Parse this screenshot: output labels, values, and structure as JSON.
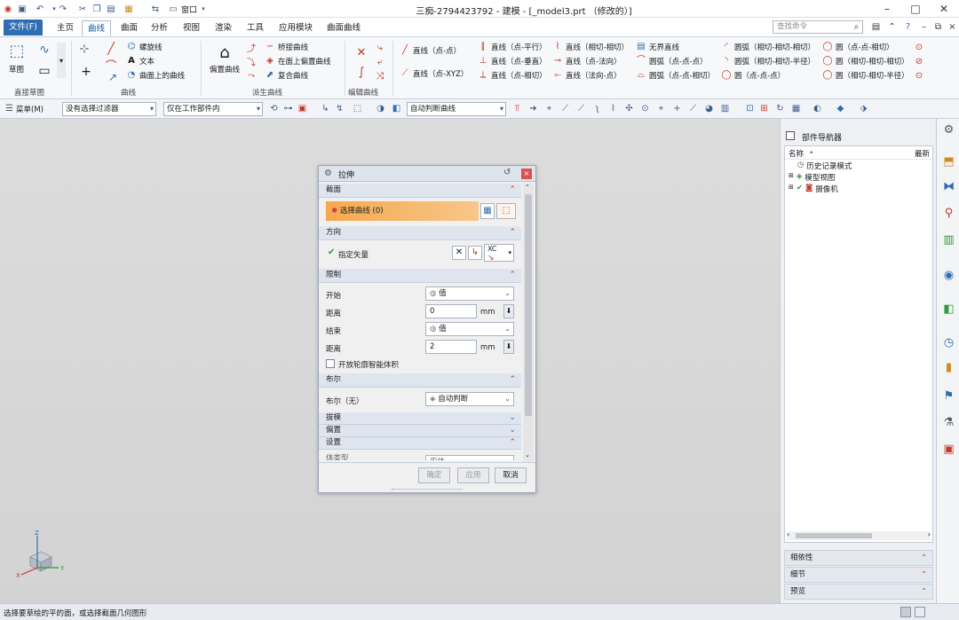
{
  "titlebar": {
    "title": "三痴-2794423792 - 建模 - [_model3.prt （修改的）]",
    "window_label": "窗口",
    "icons": [
      "nx-logo-icon",
      "save-icon",
      "undo-icon",
      "redo-icon",
      "cut-icon",
      "copy-icon",
      "paste-icon",
      "window-icon"
    ]
  },
  "menu": {
    "tabs": [
      "文件(F)",
      "主页",
      "曲线",
      "曲面",
      "分析",
      "视图",
      "渲染",
      "工具",
      "应用模块",
      "曲面曲线"
    ],
    "active": "曲线",
    "search_placeholder": "查找命令"
  },
  "ribbon": {
    "groups": {
      "direct_sketch": "直接草图",
      "curve": "曲线",
      "derived_curve": "派生曲线",
      "edit_curve": "编辑曲线"
    },
    "sketch_label": "草图",
    "curve_items": [
      "螺旋线",
      "文本",
      "曲面上的曲线"
    ],
    "offset_label": "偏置曲线",
    "derived_items": [
      "桥接曲线",
      "在面上偏置曲线",
      "复合曲线"
    ],
    "line_items": [
      "直线（点-点）",
      "直线（点-XYZ）"
    ],
    "line_items2": [
      "直线（点-平行）",
      "直线（点-垂直）",
      "直线（点-相切）"
    ],
    "line_items3": [
      "直线（相切-相切）",
      "直线（点-法向）",
      "直线（法向-点）"
    ],
    "arc_items": [
      "无界直线",
      "圆弧（点-点-点）",
      "圆弧（点-点-相切）"
    ],
    "arc_items2": [
      "圆弧（相切-相切-相切）",
      "圆弧（相切-相切-半径）",
      "圆（点-点-点）"
    ],
    "circle_items": [
      "圆（点-点-相切）",
      "圆（相切-相切-相切）",
      "圆（相切-相切-半径）"
    ]
  },
  "toolbar2": {
    "menu_label": "菜单(M)",
    "filter": "没有选择过滤器",
    "scope": "仅在工作部件内",
    "curve_rule": "自动判断曲线"
  },
  "dialog": {
    "title": "拉伸",
    "sections": {
      "section": "截面",
      "direction": "方向",
      "limits": "限制",
      "boolean": "布尔",
      "draft": "拔模",
      "offset": "偏置",
      "settings": "设置"
    },
    "select_curve": "选择曲线 (0)",
    "specify_vector": "指定矢量",
    "vector_label": "XC",
    "start_label": "开始",
    "start_value": "值",
    "start_distance_label": "距离",
    "start_distance": "0",
    "end_label": "结束",
    "end_value": "值",
    "end_distance_label": "距离",
    "end_distance": "2",
    "unit": "mm",
    "open_profile": "开放轮廓智能体积",
    "boolean_label": "布尔（无）",
    "boolean_value": "自动判断",
    "partial_label": "体类型",
    "partial_value": "实体",
    "buttons": {
      "ok": "确定",
      "apply": "应用",
      "cancel": "取消"
    }
  },
  "navigator": {
    "title": "部件导航器",
    "col_name": "名称",
    "col_recent": "最新",
    "tree": [
      "历史记录模式",
      "模型视图",
      "摄像机"
    ],
    "bottom_sections": [
      "相依性",
      "细节",
      "预览"
    ]
  },
  "axes": {
    "x": "X",
    "y": "Y",
    "z": "Z"
  },
  "status": {
    "text": "选择要草绘的平的面，或选择截面几何图形"
  },
  "colors": {
    "accent": "#2f6db3",
    "select_curve_bg": "#f0a04b",
    "chev": "#c0392b"
  }
}
